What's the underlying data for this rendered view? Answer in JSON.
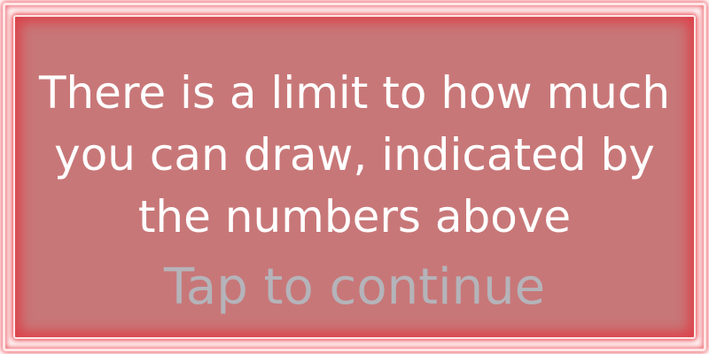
{
  "dialog": {
    "message_lines": [
      "There is a limit to how much",
      "you can draw, indicated by",
      "the numbers above"
    ],
    "continue_label": "Tap to continue"
  },
  "colors": {
    "panel_fill": "#c87778",
    "glow": "#eb4650",
    "message_text": "#ffffff",
    "continue_text": "#b4b4ba"
  }
}
